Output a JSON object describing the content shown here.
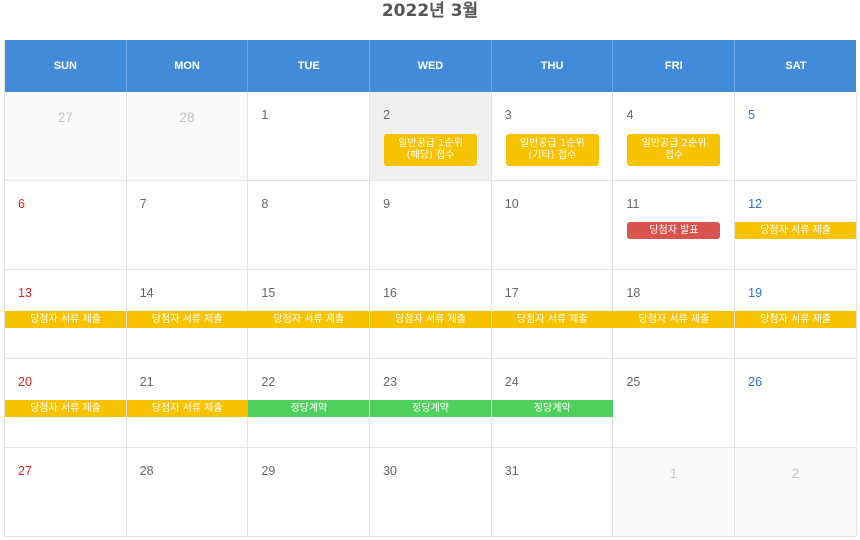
{
  "header": {
    "title": "2022년 3월"
  },
  "weekdays": [
    "SUN",
    "MON",
    "TUE",
    "WED",
    "THU",
    "FRI",
    "SAT"
  ],
  "weeks": [
    [
      "27",
      "28",
      "1",
      "2",
      "3",
      "4",
      "5"
    ],
    [
      "6",
      "7",
      "8",
      "9",
      "10",
      "11",
      "12"
    ],
    [
      "13",
      "14",
      "15",
      "16",
      "17",
      "18",
      "19"
    ],
    [
      "20",
      "21",
      "22",
      "23",
      "24",
      "25",
      "26"
    ],
    [
      "27",
      "28",
      "29",
      "30",
      "31",
      "1",
      "2"
    ]
  ],
  "events": {
    "w1_wed": "일반공급 1순위\n(해당) 접수",
    "w1_thu": "일반공급 1순위\n(기타) 접수",
    "w1_fri": "일반공급 2순위\n접수",
    "w2_fri": "당첨자 발표",
    "docs_label": "당첨자 서류 제출",
    "contract_label": "정당계약"
  },
  "colors": {
    "header_bg": "#428bda",
    "event_yellow": "#f7c200",
    "event_red": "#d9534f",
    "event_green": "#4fd05c",
    "sunday": "#e02424",
    "saturday": "#2a6fc9"
  }
}
